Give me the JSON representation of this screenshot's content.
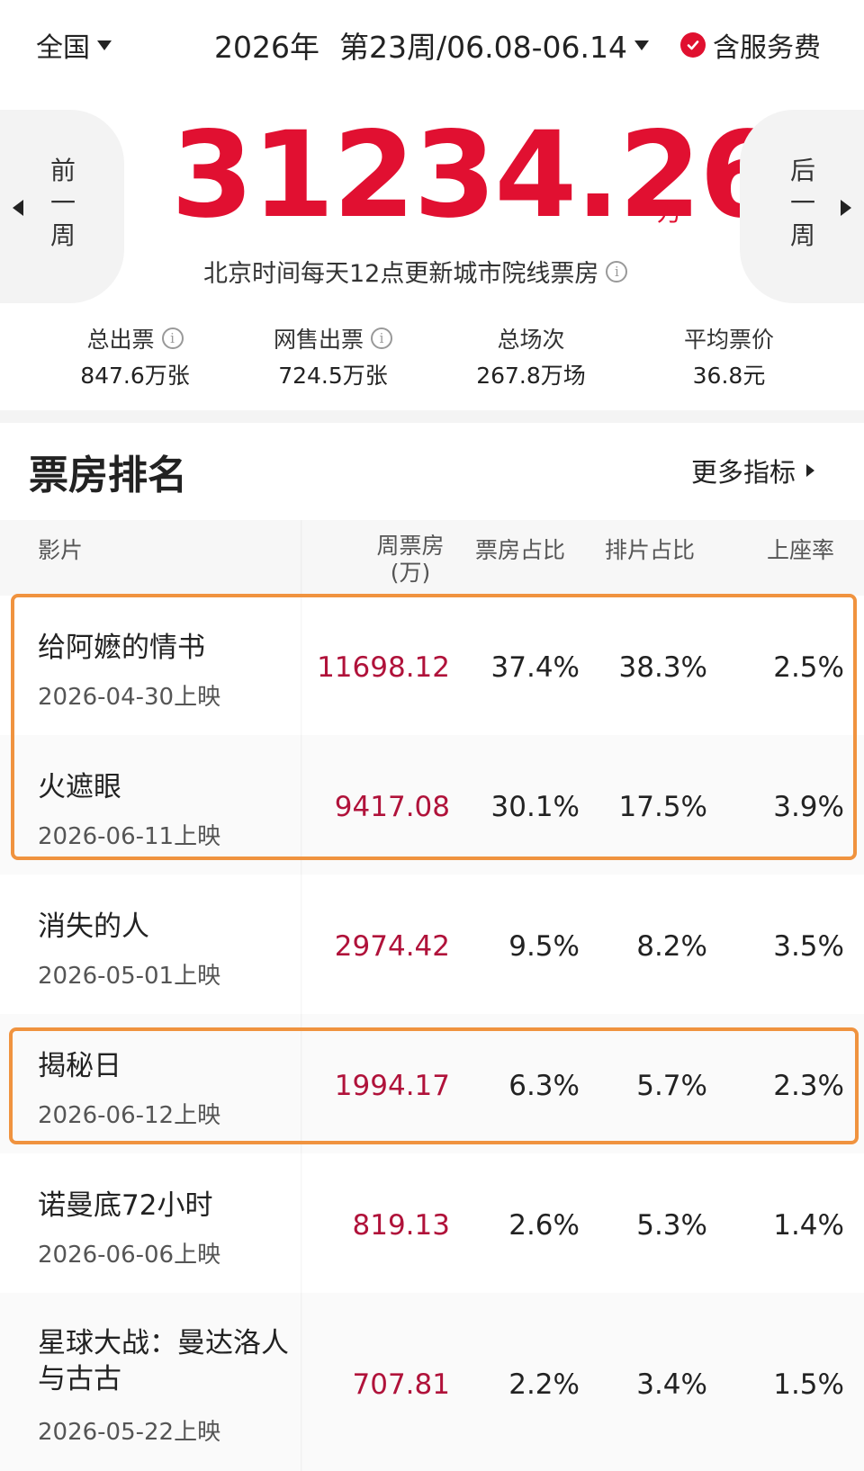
{
  "header": {
    "region": "全国",
    "year": "2026年",
    "week": "第23周/06.08-06.14",
    "service_fee": "含服务费"
  },
  "hero": {
    "prev_label": "前一周",
    "next_label": "后一周",
    "total_box_office": "31234.26",
    "unit": "万",
    "update_note": "北京时间每天12点更新城市院线票房"
  },
  "stats": [
    {
      "label": "总出票",
      "value": "847.6万张"
    },
    {
      "label": "网售出票",
      "value": "724.5万张"
    },
    {
      "label": "总场次",
      "value": "267.8万场"
    },
    {
      "label": "平均票价",
      "value": "36.8元"
    }
  ],
  "ranking": {
    "title": "票房排名",
    "more": "更多指标",
    "columns": {
      "film": "影片",
      "box": "周票房(万)",
      "share": "票房占比",
      "schedule": "排片占比",
      "seat": "上座率"
    },
    "rows": [
      {
        "name": "给阿嬷的情书",
        "date": "2026-04-30上映",
        "box": "11698.12",
        "share": "37.4%",
        "schedule": "38.3%",
        "seat": "2.5%"
      },
      {
        "name": "火遮眼",
        "date": "2026-06-11上映",
        "box": "9417.08",
        "share": "30.1%",
        "schedule": "17.5%",
        "seat": "3.9%"
      },
      {
        "name": "消失的人",
        "date": "2026-05-01上映",
        "box": "2974.42",
        "share": "9.5%",
        "schedule": "8.2%",
        "seat": "3.5%"
      },
      {
        "name": "揭秘日",
        "date": "2026-06-12上映",
        "box": "1994.17",
        "share": "6.3%",
        "schedule": "5.7%",
        "seat": "2.3%"
      },
      {
        "name": "诺曼底72小时",
        "date": "2026-06-06上映",
        "box": "819.13",
        "share": "2.6%",
        "schedule": "5.3%",
        "seat": "1.4%"
      },
      {
        "name": "星球大战：曼达洛人与古古",
        "date": "2026-05-22上映",
        "box": "707.81",
        "share": "2.2%",
        "schedule": "3.4%",
        "seat": "1.5%"
      }
    ]
  },
  "colors": {
    "accent_red": "#e11031",
    "box_value": "#b0123a",
    "highlight": "#f0933f"
  }
}
